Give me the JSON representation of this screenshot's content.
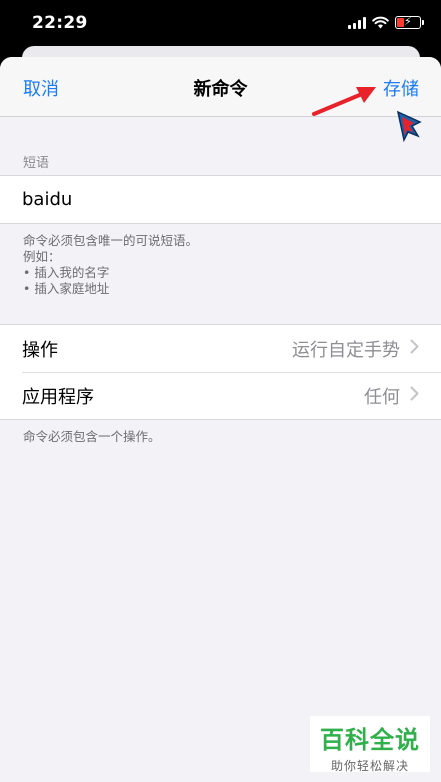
{
  "status_bar": {
    "time": "22:29"
  },
  "nav": {
    "cancel": "取消",
    "title": "新命令",
    "save": "存储"
  },
  "phrase_section": {
    "header": "短语",
    "value": "baidu",
    "footer": [
      "命令必须包含唯一的可说短语。",
      "例如：",
      "• 插入我的名字",
      "• 插入家庭地址"
    ]
  },
  "action_section": {
    "rows": [
      {
        "label": "操作",
        "value": "运行自定手势"
      },
      {
        "label": "应用程序",
        "value": "任何"
      }
    ],
    "footer": "命令必须包含一个操作。"
  },
  "watermark": {
    "main": "百科全说",
    "sub": "助你轻松解决"
  },
  "colors": {
    "accent": "#1b7cf5",
    "annotation_arrow": "#e8212a",
    "watermark_green": "#2fb04b"
  },
  "icons": [
    "signal-icon",
    "wifi-icon",
    "battery-icon",
    "chevron-right-icon",
    "cursor-pointer-icon"
  ]
}
